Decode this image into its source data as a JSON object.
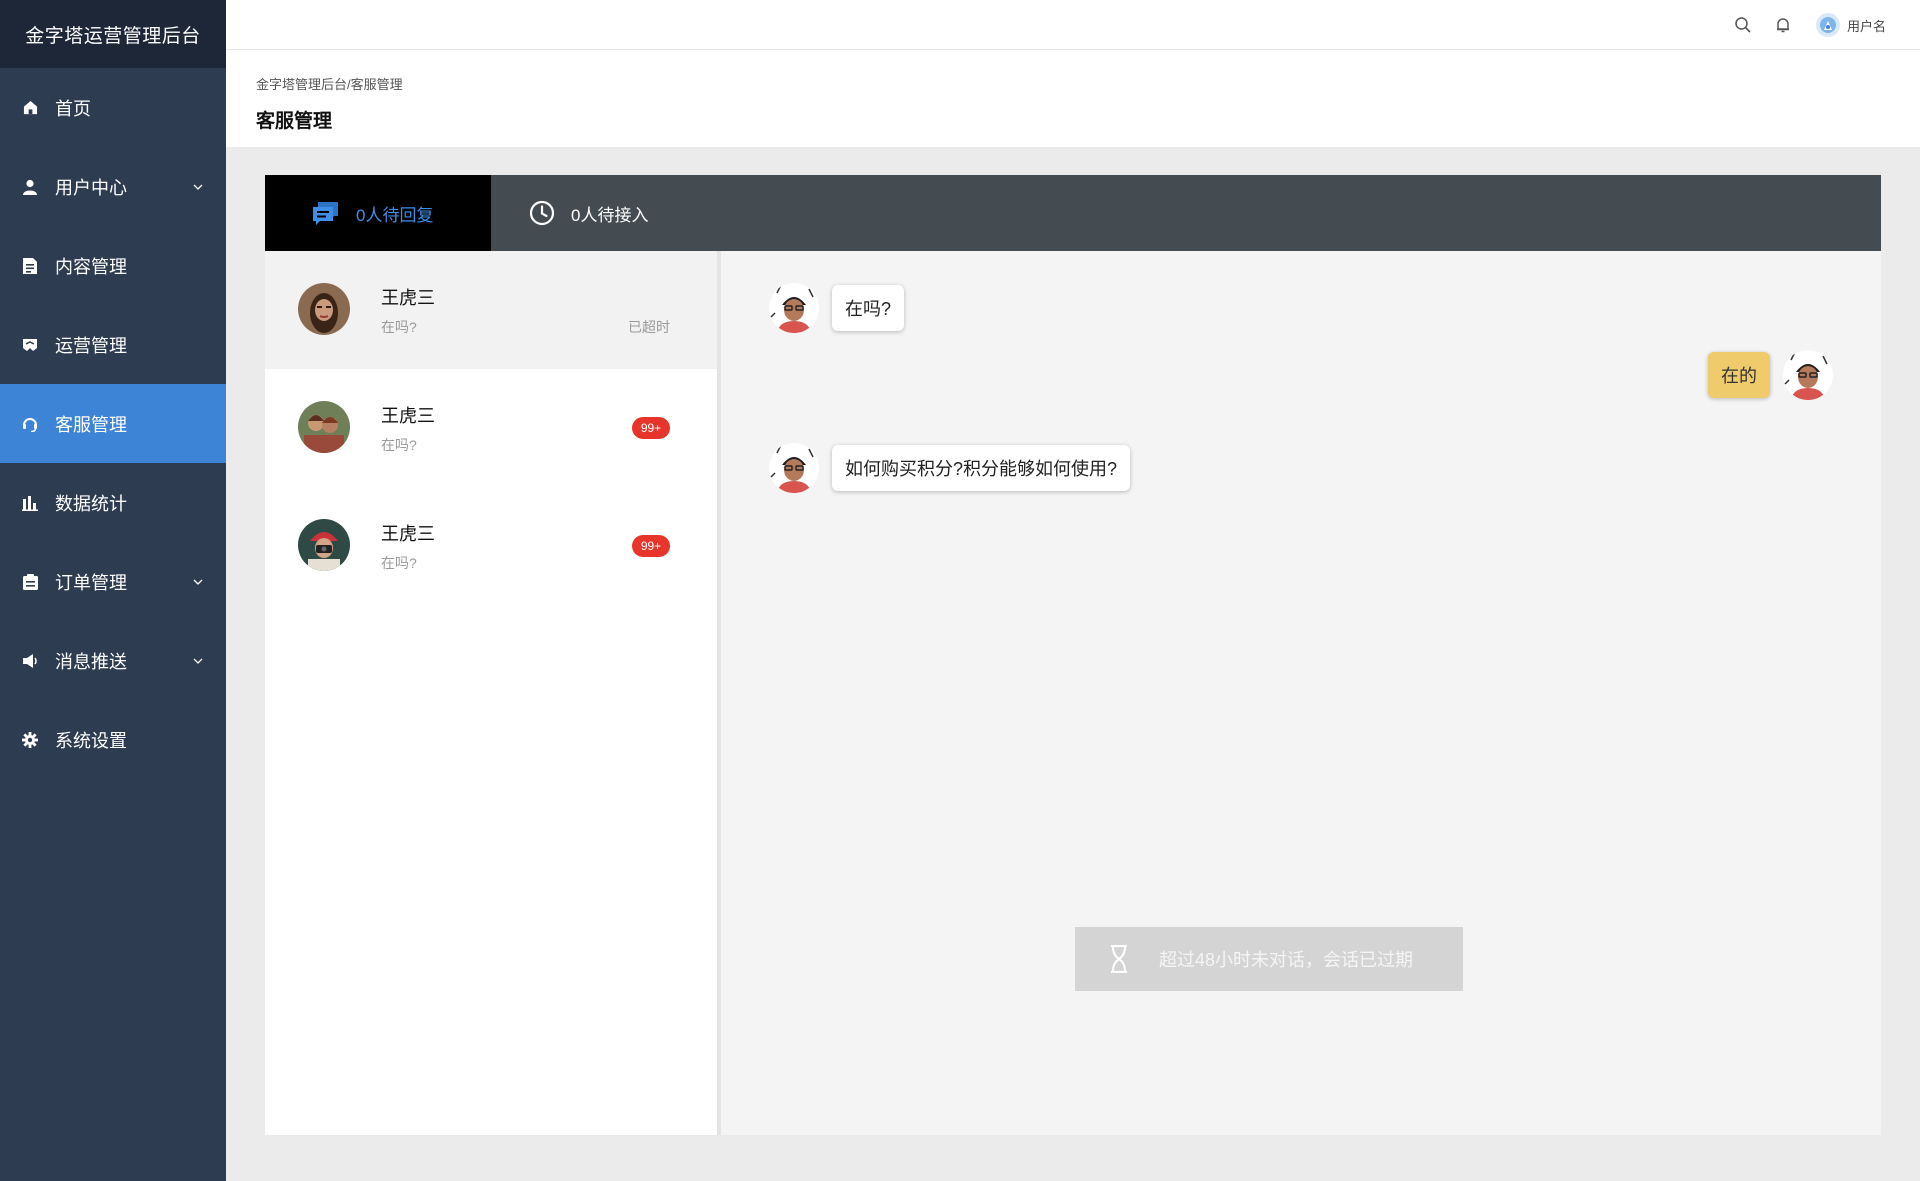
{
  "app": {
    "title": "金字塔运营管理后台"
  },
  "sidebar": {
    "items": [
      {
        "label": "首页",
        "icon": "home-icon"
      },
      {
        "label": "用户中心",
        "icon": "user-icon"
      },
      {
        "label": "内容管理",
        "icon": "document-icon"
      },
      {
        "label": "运营管理",
        "icon": "flag-icon"
      },
      {
        "label": "客服管理",
        "icon": "headset-icon"
      },
      {
        "label": "数据统计",
        "icon": "bar-chart-icon"
      },
      {
        "label": "订单管理",
        "icon": "clipboard-icon"
      },
      {
        "label": "消息推送",
        "icon": "megaphone-icon"
      },
      {
        "label": "系统设置",
        "icon": "gear-icon"
      }
    ]
  },
  "header": {
    "user_name": "用户名"
  },
  "page": {
    "breadcrumb": "金字塔管理后台/客服管理",
    "title": "客服管理"
  },
  "tabs": [
    {
      "label": "0人待回复",
      "icon": "chat-bubbles-icon"
    },
    {
      "label": "0人待接入",
      "icon": "clock-icon"
    }
  ],
  "conversations": [
    {
      "name": "王虎三",
      "last_message": "在吗?",
      "status": "已超时"
    },
    {
      "name": "王虎三",
      "last_message": "在吗?",
      "badge": "99+"
    },
    {
      "name": "王虎三",
      "last_message": "在吗?",
      "badge": "99+"
    }
  ],
  "messages": [
    {
      "side": "left",
      "text": "在吗?"
    },
    {
      "side": "right",
      "text": "在的"
    },
    {
      "side": "left",
      "text": "如何购买积分?积分能够如何使用?"
    }
  ],
  "expired_notice": "超过48小时未对话，会话已过期",
  "colors": {
    "sidebar_bg": "#2e3c51",
    "sidebar_active": "#3d84d6",
    "tab_active_text": "#3e8ee6",
    "badge_red": "#e8352b",
    "my_bubble": "#f0cb6c"
  }
}
